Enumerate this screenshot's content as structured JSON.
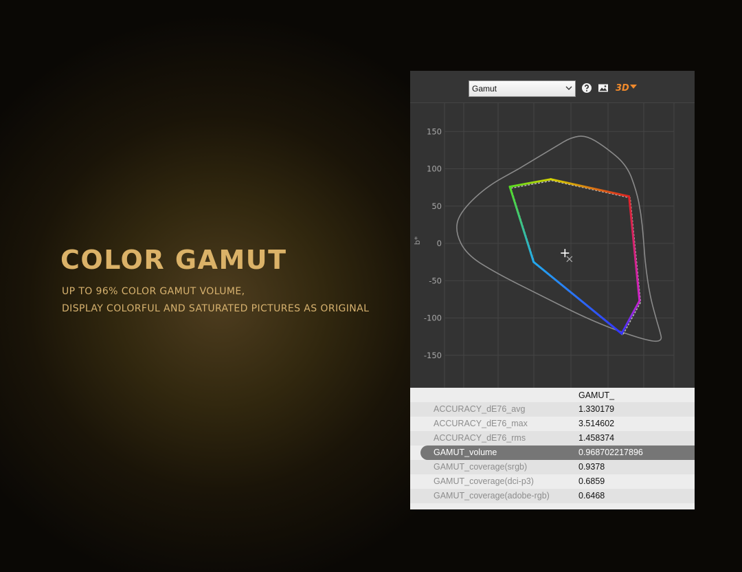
{
  "hero": {
    "title": "COLOR GAMUT",
    "line1": "UP TO 96% COLOR GAMUT VOLUME,",
    "line2": "DISPLAY COLORFUL AND SATURATED PICTURES AS ORIGINAL"
  },
  "toolbar": {
    "select_value": "Gamut",
    "help_icon": "help-icon",
    "image_icon": "image-icon",
    "mode_label": "3D",
    "accent": "#f08a2c"
  },
  "chart_data": {
    "type": "scatter",
    "ylabel": "b*",
    "yticks": [
      150,
      100,
      50,
      0,
      -50,
      -100,
      -150
    ],
    "ylim": [
      -190,
      190
    ],
    "xlim": [
      -170,
      140
    ],
    "grid": true,
    "reference_outline": [
      [
        -70,
        100
      ],
      [
        -20,
        130
      ],
      [
        0,
        142
      ],
      [
        20,
        145
      ],
      [
        45,
        130
      ],
      [
        75,
        105
      ],
      [
        88,
        70
      ],
      [
        94,
        40
      ],
      [
        97,
        10
      ],
      [
        100,
        -30
      ],
      [
        106,
        -70
      ],
      [
        114,
        -100
      ],
      [
        120,
        -120
      ],
      [
        122,
        -130
      ],
      [
        110,
        -132
      ],
      [
        70,
        -120
      ],
      [
        20,
        -100
      ],
      [
        -40,
        -70
      ],
      [
        -100,
        -40
      ],
      [
        -140,
        -15
      ],
      [
        -155,
        15
      ],
      [
        -150,
        40
      ],
      [
        -115,
        75
      ],
      [
        -70,
        100
      ]
    ],
    "gamut_polygon": [
      [
        -82,
        76
      ],
      [
        -27,
        86
      ],
      [
        78,
        63
      ],
      [
        92,
        -77
      ],
      [
        68,
        -121
      ],
      [
        -50,
        -25
      ],
      [
        -82,
        76
      ]
    ],
    "gamut_colors": [
      "#55dd22",
      "#d4d400",
      "#dd2222",
      "#cc22cc",
      "#3333ff",
      "#22aaee",
      "#55dd22"
    ],
    "target_point": [
      -8,
      -13
    ],
    "white_point": [
      -2,
      -21
    ]
  },
  "table": {
    "column_header": "GAMUT_",
    "rows": [
      {
        "key": "ACCURACY_dE76_avg",
        "value": "1.330179"
      },
      {
        "key": "ACCURACY_dE76_max",
        "value": "3.514602"
      },
      {
        "key": "ACCURACY_dE76_rms",
        "value": "1.458374"
      },
      {
        "key": "GAMUT_volume",
        "value": "0.968702217896"
      },
      {
        "key": "GAMUT_coverage(srgb)",
        "value": "0.9378"
      },
      {
        "key": "GAMUT_coverage(dci-p3)",
        "value": "0.6859"
      },
      {
        "key": "GAMUT_coverage(adobe-rgb)",
        "value": "0.6468"
      }
    ],
    "highlighted_row": 3
  }
}
